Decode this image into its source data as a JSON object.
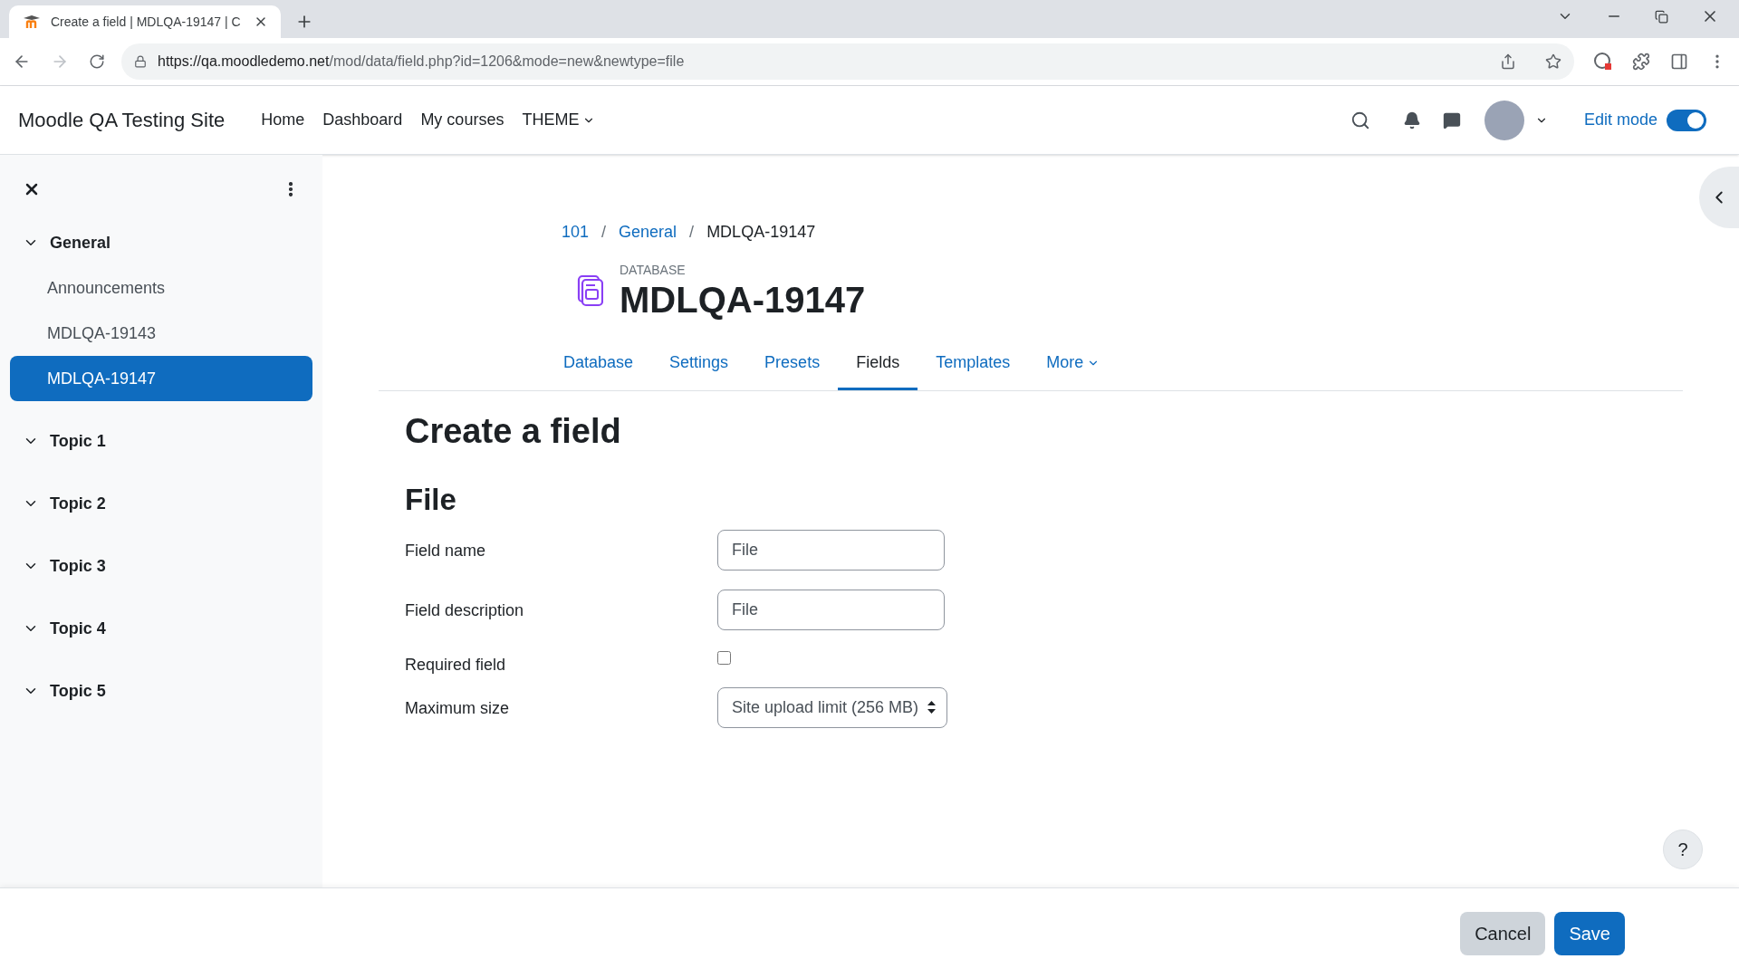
{
  "browser": {
    "tab_title": "Create a field | MDLQA-19147 | C",
    "url_host": "https://qa.moodledemo.net",
    "url_path": "/mod/data/field.php?id=1206&mode=new&newtype=file"
  },
  "navbar": {
    "site_name": "Moodle QA Testing Site",
    "items": [
      {
        "label": "Home",
        "kind": "link"
      },
      {
        "label": "Dashboard",
        "kind": "link"
      },
      {
        "label": "My courses",
        "kind": "link"
      },
      {
        "label": "THEME",
        "kind": "dropdown"
      }
    ],
    "edit_mode": {
      "label": "Edit mode",
      "on": true
    }
  },
  "sidebar": {
    "sections": [
      {
        "title": "General",
        "expanded": true,
        "children": [
          {
            "label": "Announcements",
            "selected": false
          },
          {
            "label": "MDLQA-19143",
            "selected": false
          },
          {
            "label": "MDLQA-19147",
            "selected": true
          }
        ]
      },
      {
        "title": "Topic 1",
        "expanded": true
      },
      {
        "title": "Topic 2",
        "expanded": true
      },
      {
        "title": "Topic 3",
        "expanded": true
      },
      {
        "title": "Topic 4",
        "expanded": true
      },
      {
        "title": "Topic 5",
        "expanded": true
      }
    ]
  },
  "breadcrumb": [
    {
      "label": "101",
      "link": true
    },
    {
      "separator": "/",
      "label": "General",
      "link": true
    },
    {
      "separator": "/",
      "label": "MDLQA-19147",
      "link": false
    }
  ],
  "activity": {
    "type_label": "DATABASE",
    "title": "MDLQA-19147"
  },
  "tabs": [
    {
      "label": "Database",
      "selected": false,
      "dropdown": false
    },
    {
      "label": "Settings",
      "selected": false,
      "dropdown": false
    },
    {
      "label": "Presets",
      "selected": false,
      "dropdown": false
    },
    {
      "label": "Fields",
      "selected": true,
      "dropdown": false
    },
    {
      "label": "Templates",
      "selected": false,
      "dropdown": false
    },
    {
      "label": "More",
      "selected": false,
      "dropdown": true
    }
  ],
  "page_title": "Create a field",
  "section_title": "File",
  "form": [
    {
      "kind": "text",
      "label": "Field name",
      "value": "File"
    },
    {
      "kind": "text",
      "label": "Field description",
      "value": "File"
    },
    {
      "kind": "checkbox",
      "label": "Required field",
      "checked": false
    },
    {
      "kind": "select",
      "label": "Maximum size",
      "value": "Site upload limit (256 MB)"
    }
  ],
  "footer": {
    "buttons": [
      {
        "label": "Cancel",
        "kind": "secondary"
      },
      {
        "label": "Save",
        "kind": "primary"
      }
    ],
    "help": "?"
  }
}
